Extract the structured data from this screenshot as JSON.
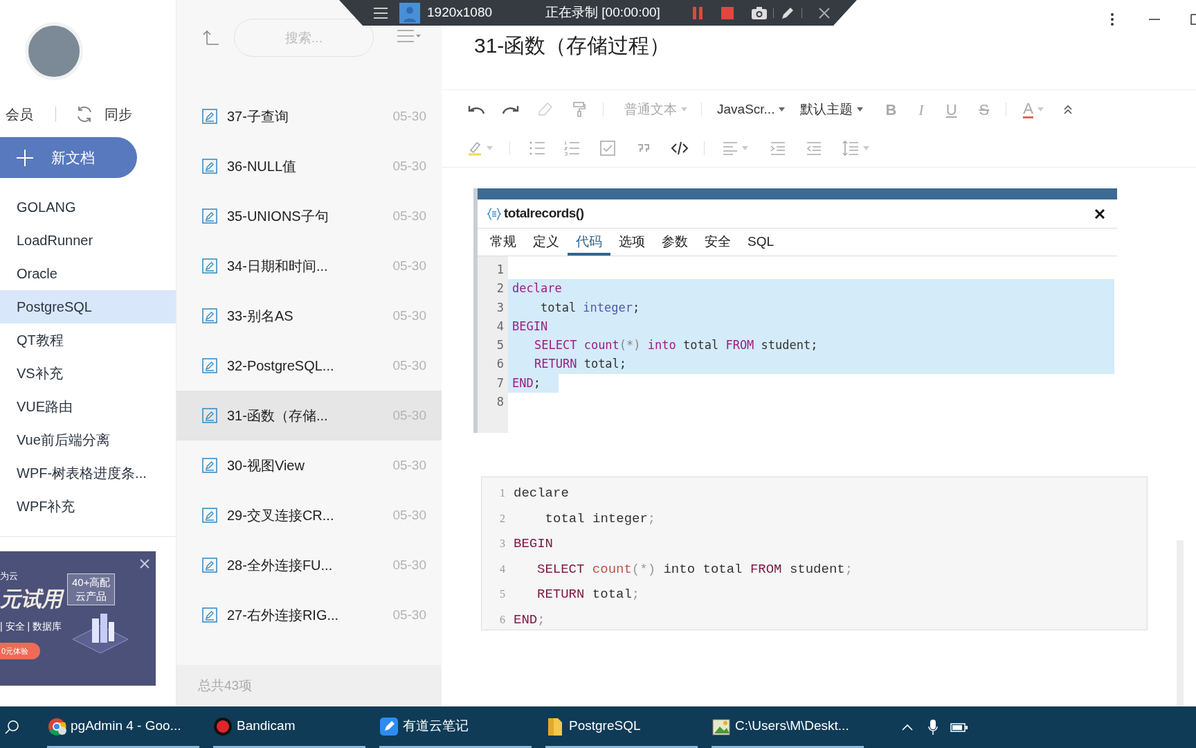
{
  "recorder_bar": {
    "resolution": "1920x1080",
    "status": "正在录制 [00:00:00]"
  },
  "sidebar": {
    "member_label": "会员",
    "sync_label": "同步",
    "new_doc_button": "新文档",
    "folders": [
      {
        "label": "GOLANG",
        "selected": false
      },
      {
        "label": "LoadRunner",
        "selected": false
      },
      {
        "label": "Oracle",
        "selected": false
      },
      {
        "label": "PostgreSQL",
        "selected": true
      },
      {
        "label": "QT教程",
        "selected": false
      },
      {
        "label": "VS补充",
        "selected": false
      },
      {
        "label": "VUE路由",
        "selected": false
      },
      {
        "label": "Vue前后端分离",
        "selected": false
      },
      {
        "label": "WPF-树表格进度条...",
        "selected": false
      },
      {
        "label": "WPF补充",
        "selected": false
      }
    ],
    "ad": {
      "brand": "为云",
      "headline": "元试用",
      "badge_top": "40+高配",
      "badge_bottom": "云产品",
      "tags": "| 安全 | 数据库",
      "cta": "0元体验"
    }
  },
  "note_list": {
    "search_placeholder": "搜索...",
    "notes": [
      {
        "title": "37-子查询",
        "date": "05-30",
        "selected": false
      },
      {
        "title": "36-NULL值",
        "date": "05-30",
        "selected": false
      },
      {
        "title": "35-UNIONS子句",
        "date": "05-30",
        "selected": false
      },
      {
        "title": "34-日期和时间...",
        "date": "05-30",
        "selected": false
      },
      {
        "title": "33-别名AS",
        "date": "05-30",
        "selected": false
      },
      {
        "title": "32-PostgreSQL...",
        "date": "05-30",
        "selected": false
      },
      {
        "title": "31-函数（存储...",
        "date": "05-30",
        "selected": true
      },
      {
        "title": "30-视图View",
        "date": "05-30",
        "selected": false
      },
      {
        "title": "29-交叉连接CR...",
        "date": "05-30",
        "selected": false
      },
      {
        "title": "28-全外连接FU...",
        "date": "05-30",
        "selected": false
      },
      {
        "title": "27-右外连接RIG...",
        "date": "05-30",
        "selected": false
      }
    ],
    "footer": "总共43项"
  },
  "editor": {
    "title": "31-函数（存储过程）",
    "dropdowns": [
      {
        "label": "普通文本",
        "disabled": true
      },
      {
        "label": "JavaScr...",
        "disabled": false
      },
      {
        "label": "默认主题",
        "disabled": false
      }
    ],
    "format_buttons": [
      {
        "kind": "bold",
        "label": "B"
      },
      {
        "kind": "italic",
        "label": "I"
      },
      {
        "kind": "underline",
        "label": "U"
      },
      {
        "kind": "strike",
        "label": "S"
      },
      {
        "kind": "font_color",
        "label": "A"
      }
    ],
    "embedded_dialog": {
      "title": "totalrecords()",
      "tabs": [
        {
          "label": "常规",
          "selected": false
        },
        {
          "label": "定义",
          "selected": false
        },
        {
          "label": "代码",
          "selected": true
        },
        {
          "label": "选项",
          "selected": false
        },
        {
          "label": "参数",
          "selected": false
        },
        {
          "label": "安全",
          "selected": false
        },
        {
          "label": "SQL",
          "selected": false
        }
      ],
      "lines": [
        {
          "number": "1",
          "selected": false
        },
        {
          "number": "2",
          "selected": true,
          "full_width": true,
          "indented": false,
          "tokens": [
            {
              "kind": "keyword",
              "text": "declare"
            }
          ]
        },
        {
          "number": "3",
          "selected": true,
          "full_width": true,
          "indented": false,
          "tokens": [
            {
              "kind": "plain",
              "text": "    total"
            },
            {
              "kind": "type",
              "text": " integer"
            },
            {
              "kind": "plain",
              "text": ";"
            }
          ]
        },
        {
          "number": "4",
          "selected": true,
          "full_width": true,
          "indented": false,
          "tokens": [
            {
              "kind": "keyword",
              "text": "BEGIN"
            }
          ]
        },
        {
          "number": "5",
          "selected": true,
          "full_width": true,
          "indented": true,
          "tokens": [
            {
              "kind": "keyword",
              "text": "SELECT"
            },
            {
              "kind": "function",
              "text": " count"
            },
            {
              "kind": "punct",
              "text": "(*)"
            },
            {
              "kind": "keyword",
              "text": " into"
            },
            {
              "kind": "plain",
              "text": " total "
            },
            {
              "kind": "keyword",
              "text": "FROM"
            },
            {
              "kind": "plain",
              "text": " student;"
            }
          ]
        },
        {
          "number": "6",
          "selected": true,
          "full_width": true,
          "indented": true,
          "tokens": [
            {
              "kind": "keyword",
              "text": "RETURN"
            },
            {
              "kind": "plain",
              "text": " total;"
            }
          ]
        },
        {
          "number": "7",
          "selected": true,
          "full_width": false,
          "indented": false,
          "tokens": [
            {
              "kind": "keyword",
              "text": "END"
            },
            {
              "kind": "plain",
              "text": ";"
            }
          ]
        },
        {
          "number": "8",
          "selected": false
        }
      ]
    },
    "code_block": {
      "lines": [
        {
          "number": "1",
          "tokens": [
            {
              "kind": "plain",
              "text": "declare"
            }
          ]
        },
        {
          "number": "2",
          "tokens": [
            {
              "kind": "plain",
              "text": "    total integer"
            },
            {
              "kind": "punct",
              "text": ";"
            }
          ]
        },
        {
          "number": "3",
          "tokens": [
            {
              "kind": "keyword",
              "text": "BEGIN"
            }
          ]
        },
        {
          "number": "4",
          "indented": true,
          "tokens": [
            {
              "kind": "keyword",
              "text": "SELECT"
            },
            {
              "kind": "function",
              "text": " count"
            },
            {
              "kind": "punct",
              "text": "(*)"
            },
            {
              "kind": "plain",
              "text": " into total "
            },
            {
              "kind": "keyword",
              "text": "FROM"
            },
            {
              "kind": "plain",
              "text": " student"
            },
            {
              "kind": "punct",
              "text": ";"
            }
          ]
        },
        {
          "number": "5",
          "indented": true,
          "tokens": [
            {
              "kind": "keyword",
              "text": "RETURN"
            },
            {
              "kind": "plain",
              "text": " total"
            },
            {
              "kind": "punct",
              "text": ";"
            }
          ]
        },
        {
          "number": "6",
          "tokens": [
            {
              "kind": "keyword",
              "text": "END"
            },
            {
              "kind": "punct",
              "text": ";"
            }
          ]
        }
      ]
    }
  },
  "taskbar": {
    "items": [
      {
        "label": "pgAdmin 4 - Goo...",
        "open": true
      },
      {
        "label": "Bandicam",
        "open": true
      },
      {
        "label": "有道云笔记",
        "open": true
      },
      {
        "label": "PostgreSQL",
        "open": true
      },
      {
        "label": "C:\\Users\\M\\Deskt...",
        "open": true
      }
    ]
  }
}
